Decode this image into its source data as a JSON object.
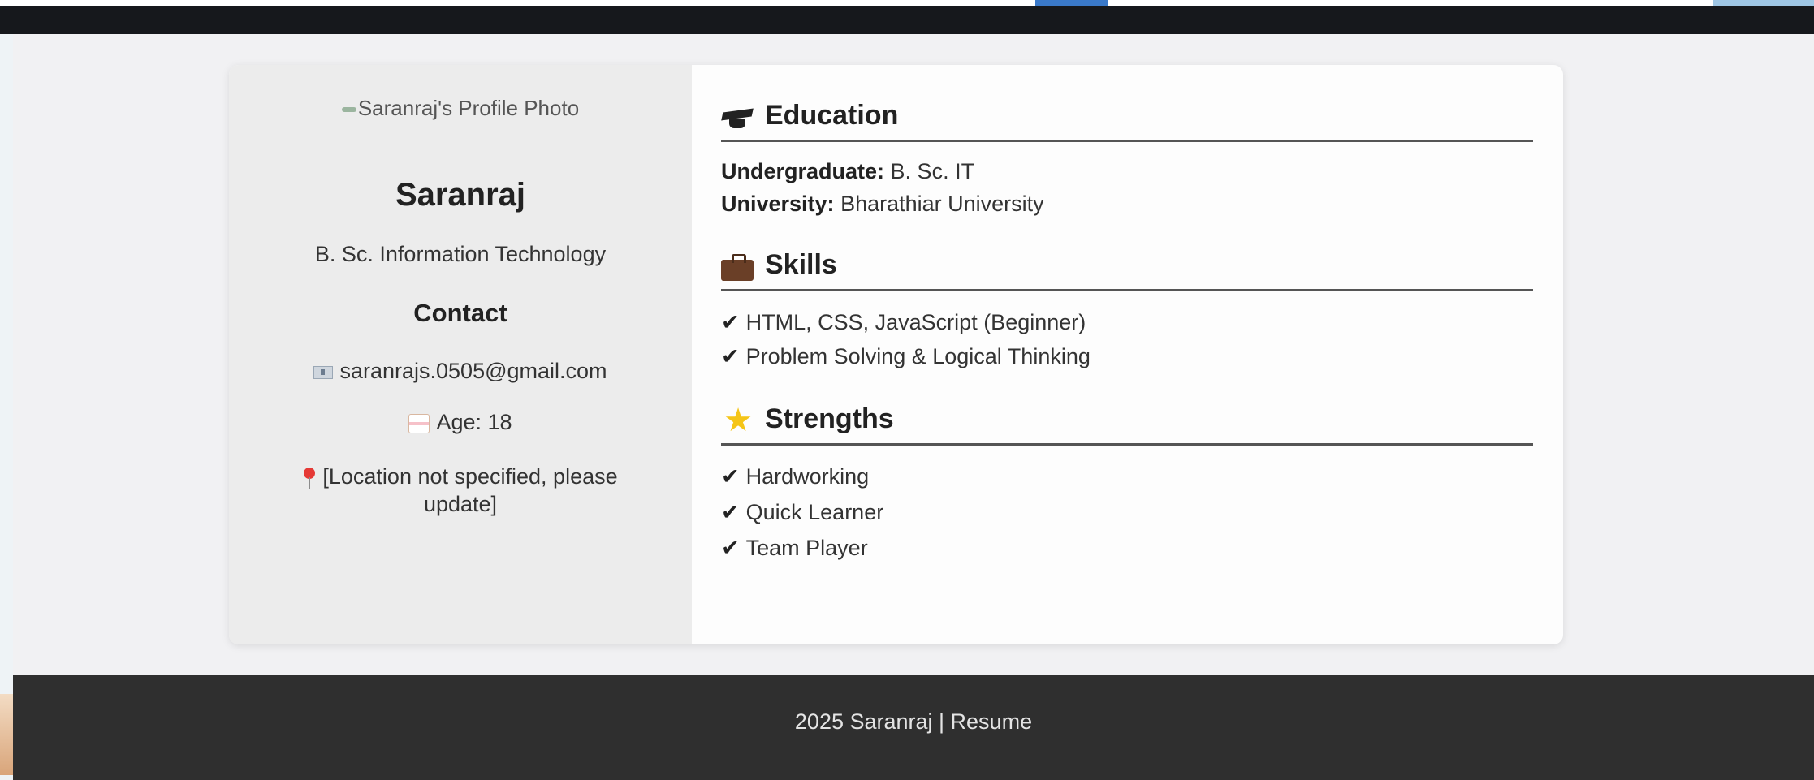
{
  "profile": {
    "photo_alt": "Saranraj's Profile Photo",
    "name": "Saranraj",
    "degree": "B. Sc. Information Technology",
    "contact_title": "Contact",
    "email": "saranrajs.0505@gmail.com",
    "age": "Age: 18",
    "location": "[Location not specified, please update]"
  },
  "education": {
    "title": "Education",
    "icon": "graduation-cap-icon",
    "undergraduate_label": "Undergraduate:",
    "undergraduate_value": "B. Sc. IT",
    "university_label": "University:",
    "university_value": "Bharathiar University"
  },
  "skills": {
    "title": "Skills",
    "icon": "briefcase-icon",
    "items": [
      "HTML, CSS, JavaScript (Beginner)",
      "Problem Solving & Logical Thinking"
    ]
  },
  "strengths": {
    "title": "Strengths",
    "icon": "star-icon",
    "items": [
      "Hardworking",
      "Quick Learner",
      "Team Player"
    ]
  },
  "footer": {
    "text": "2025 Saranraj | Resume"
  },
  "icons": {
    "email": "envelope-icon",
    "age": "birthday-cake-icon",
    "location": "map-pin-icon",
    "check": "✔"
  },
  "colors": {
    "top_bar": "#16181c",
    "sidebar": "#ececec",
    "footer": "#2f2f2f",
    "page_bg": "#f1f1f3"
  }
}
